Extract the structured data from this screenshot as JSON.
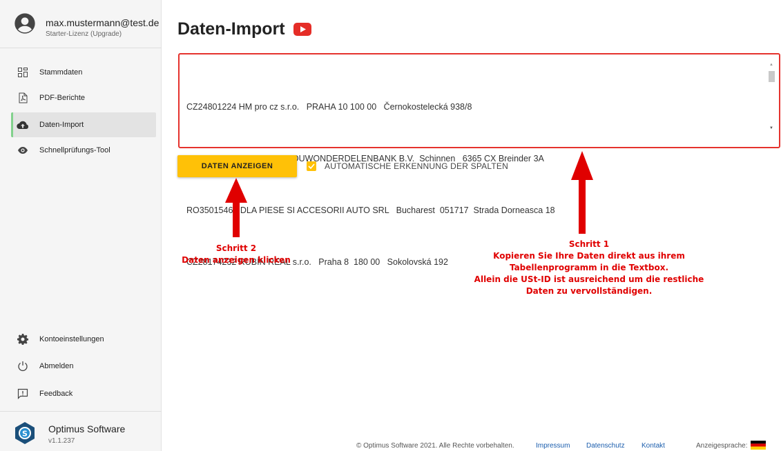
{
  "user": {
    "email": "max.mustermann@test.de",
    "license": "Starter-Lizenz (Upgrade)"
  },
  "nav": {
    "items": [
      {
        "label": "Stammdaten",
        "icon": "grid-icon"
      },
      {
        "label": "PDF-Berichte",
        "icon": "pdf-icon"
      },
      {
        "label": "Daten-Import",
        "icon": "cloud-upload-icon"
      },
      {
        "label": "Schnellprüfungs-Tool",
        "icon": "eye-icon"
      }
    ],
    "bottom_items": [
      {
        "label": "Kontoeinstellungen",
        "icon": "gear-icon"
      },
      {
        "label": "Abmelden",
        "icon": "power-icon"
      },
      {
        "label": "Feedback",
        "icon": "feedback-icon"
      }
    ]
  },
  "brand": {
    "name": "Optimus Software",
    "version": "v1.1.237"
  },
  "page": {
    "title": "Daten-Import"
  },
  "import": {
    "lines": [
      "CZ24801224 HM pro cz s.r.o.   PRAHA 10 100 00   Černokostelecká 938/8",
      "NL804085961B01   LANDBOUWONDERDELENBANK B.V.  Schinnen   6365 CX Breinder 3A",
      "RO35015462 DLA PIESE SI ACCESORII AUTO SRL   Bucharest  051717  Strada Dorneasca 18",
      "CZ28174232 RUBÍN REAL s.r.o.   Praha 8  180 00   Sokolovská 192"
    ],
    "show_button": "DATEN ANZEIGEN",
    "auto_detect_label": "AUTOMATISCHE ERKENNUNG DER SPALTEN",
    "auto_detect_checked": true
  },
  "annotations": {
    "step2": [
      "Schritt 2",
      "Daten anzeigen klicken"
    ],
    "step1": [
      "Schritt 1",
      "Kopieren Sie Ihre Daten direkt aus ihrem",
      "Tabellenprogramm in die Textbox.",
      "Allein die USt-ID ist ausreichend um die restliche",
      "Daten zu vervollständigen."
    ]
  },
  "footer": {
    "copyright": "© Optimus Software 2021. Alle Rechte vorbehalten.",
    "impressum": "Impressum",
    "datenschutz": "Datenschutz",
    "kontakt": "Kontakt",
    "language_label": "Anzeigesprache:"
  },
  "colors": {
    "accent": "#ffc107",
    "annotation": "#e00000",
    "nav_active_border": "#82d18c",
    "link": "#1a5dad"
  }
}
